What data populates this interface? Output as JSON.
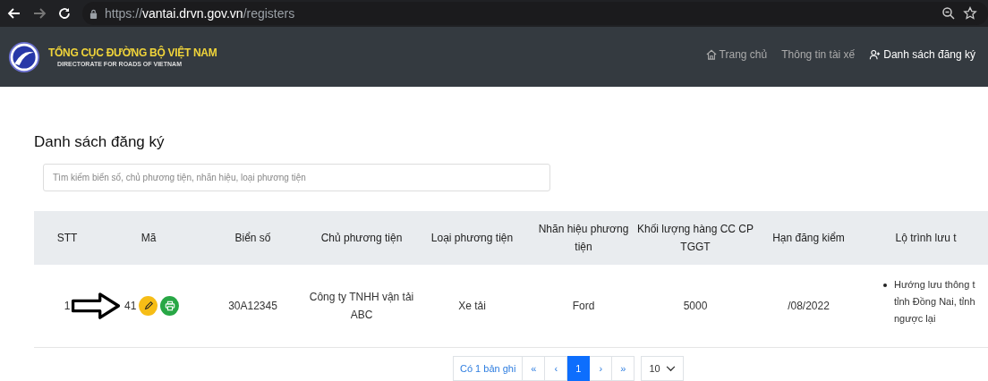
{
  "browser": {
    "url_host": "https://",
    "url_domain": "vantai.drvn.gov.vn",
    "url_path": "/registers"
  },
  "header": {
    "title": "TỔNG CỤC ĐƯỜNG BỘ VIỆT NAM",
    "subtitle": "DIRECTORATE FOR ROADS OF VIETNAM",
    "nav": [
      {
        "label": "Trang chủ",
        "kind": "home",
        "selected": false
      },
      {
        "label": "Thông tin tài xế",
        "kind": "plain",
        "selected": false
      },
      {
        "label": "Danh sách đăng ký",
        "kind": "user",
        "selected": true
      }
    ]
  },
  "page_title": "Danh sách đăng ký",
  "search": {
    "placeholder": "Tìm kiếm biển số, chủ phương tiện, nhãn hiệu, loại phương tiện"
  },
  "table": {
    "columns": [
      "STT",
      "Mã",
      "Biển số",
      "Chủ phương tiện",
      "Loại phương tiện",
      "Nhãn hiệu phương tiện",
      "Khối lượng hàng CC CP TGGT",
      "Hạn đăng kiểm",
      "Lộ trình lưu t"
    ],
    "rows": [
      {
        "stt": "1",
        "code": "41",
        "plate": "30A12345",
        "owner": "Công ty TNHH vận tải ABC",
        "type": "Xe tải",
        "brand": "Ford",
        "weight": "5000",
        "expiry": "/08/2022",
        "route": [
          "Hướng lưu thông t",
          "tỉnh Đồng Nai, tỉnh",
          "ngược lại"
        ]
      }
    ]
  },
  "pagination": {
    "summary": "Có 1 bản ghi",
    "controls": [
      {
        "label": "«",
        "selected": false
      },
      {
        "label": "‹",
        "selected": false
      },
      {
        "label": "1",
        "selected": true
      },
      {
        "label": "›",
        "selected": false
      },
      {
        "label": "»",
        "selected": false
      }
    ],
    "page_size": "10"
  }
}
